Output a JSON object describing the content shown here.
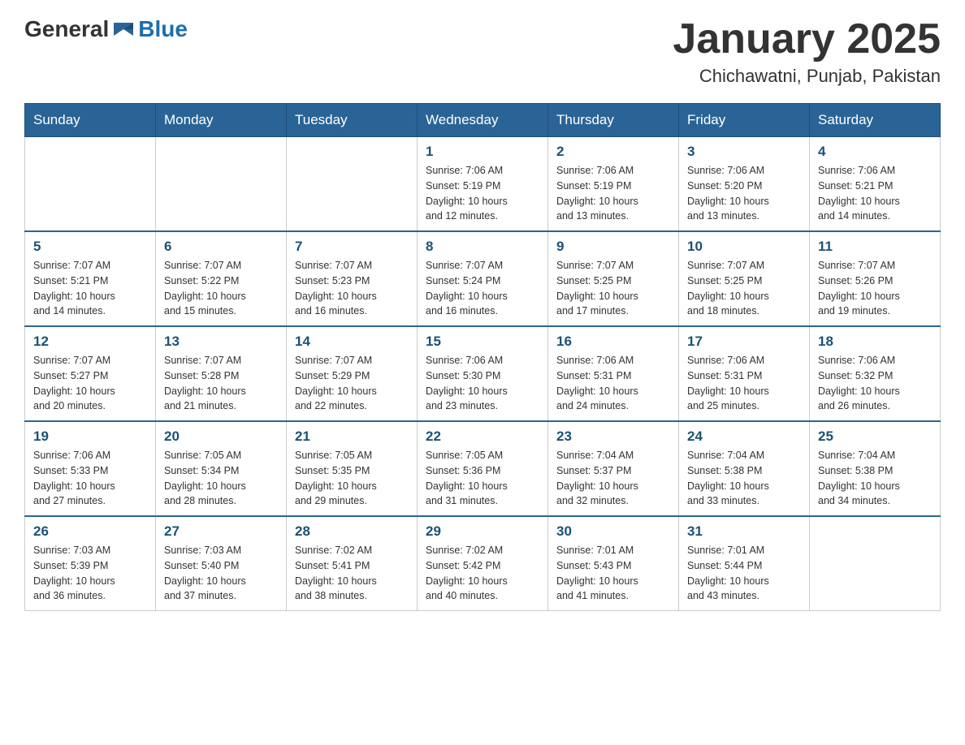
{
  "header": {
    "logo_general": "General",
    "logo_blue": "Blue",
    "month_title": "January 2025",
    "location": "Chichawatni, Punjab, Pakistan"
  },
  "weekdays": [
    "Sunday",
    "Monday",
    "Tuesday",
    "Wednesday",
    "Thursday",
    "Friday",
    "Saturday"
  ],
  "weeks": [
    [
      {
        "day": "",
        "info": ""
      },
      {
        "day": "",
        "info": ""
      },
      {
        "day": "",
        "info": ""
      },
      {
        "day": "1",
        "info": "Sunrise: 7:06 AM\nSunset: 5:19 PM\nDaylight: 10 hours\nand 12 minutes."
      },
      {
        "day": "2",
        "info": "Sunrise: 7:06 AM\nSunset: 5:19 PM\nDaylight: 10 hours\nand 13 minutes."
      },
      {
        "day": "3",
        "info": "Sunrise: 7:06 AM\nSunset: 5:20 PM\nDaylight: 10 hours\nand 13 minutes."
      },
      {
        "day": "4",
        "info": "Sunrise: 7:06 AM\nSunset: 5:21 PM\nDaylight: 10 hours\nand 14 minutes."
      }
    ],
    [
      {
        "day": "5",
        "info": "Sunrise: 7:07 AM\nSunset: 5:21 PM\nDaylight: 10 hours\nand 14 minutes."
      },
      {
        "day": "6",
        "info": "Sunrise: 7:07 AM\nSunset: 5:22 PM\nDaylight: 10 hours\nand 15 minutes."
      },
      {
        "day": "7",
        "info": "Sunrise: 7:07 AM\nSunset: 5:23 PM\nDaylight: 10 hours\nand 16 minutes."
      },
      {
        "day": "8",
        "info": "Sunrise: 7:07 AM\nSunset: 5:24 PM\nDaylight: 10 hours\nand 16 minutes."
      },
      {
        "day": "9",
        "info": "Sunrise: 7:07 AM\nSunset: 5:25 PM\nDaylight: 10 hours\nand 17 minutes."
      },
      {
        "day": "10",
        "info": "Sunrise: 7:07 AM\nSunset: 5:25 PM\nDaylight: 10 hours\nand 18 minutes."
      },
      {
        "day": "11",
        "info": "Sunrise: 7:07 AM\nSunset: 5:26 PM\nDaylight: 10 hours\nand 19 minutes."
      }
    ],
    [
      {
        "day": "12",
        "info": "Sunrise: 7:07 AM\nSunset: 5:27 PM\nDaylight: 10 hours\nand 20 minutes."
      },
      {
        "day": "13",
        "info": "Sunrise: 7:07 AM\nSunset: 5:28 PM\nDaylight: 10 hours\nand 21 minutes."
      },
      {
        "day": "14",
        "info": "Sunrise: 7:07 AM\nSunset: 5:29 PM\nDaylight: 10 hours\nand 22 minutes."
      },
      {
        "day": "15",
        "info": "Sunrise: 7:06 AM\nSunset: 5:30 PM\nDaylight: 10 hours\nand 23 minutes."
      },
      {
        "day": "16",
        "info": "Sunrise: 7:06 AM\nSunset: 5:31 PM\nDaylight: 10 hours\nand 24 minutes."
      },
      {
        "day": "17",
        "info": "Sunrise: 7:06 AM\nSunset: 5:31 PM\nDaylight: 10 hours\nand 25 minutes."
      },
      {
        "day": "18",
        "info": "Sunrise: 7:06 AM\nSunset: 5:32 PM\nDaylight: 10 hours\nand 26 minutes."
      }
    ],
    [
      {
        "day": "19",
        "info": "Sunrise: 7:06 AM\nSunset: 5:33 PM\nDaylight: 10 hours\nand 27 minutes."
      },
      {
        "day": "20",
        "info": "Sunrise: 7:05 AM\nSunset: 5:34 PM\nDaylight: 10 hours\nand 28 minutes."
      },
      {
        "day": "21",
        "info": "Sunrise: 7:05 AM\nSunset: 5:35 PM\nDaylight: 10 hours\nand 29 minutes."
      },
      {
        "day": "22",
        "info": "Sunrise: 7:05 AM\nSunset: 5:36 PM\nDaylight: 10 hours\nand 31 minutes."
      },
      {
        "day": "23",
        "info": "Sunrise: 7:04 AM\nSunset: 5:37 PM\nDaylight: 10 hours\nand 32 minutes."
      },
      {
        "day": "24",
        "info": "Sunrise: 7:04 AM\nSunset: 5:38 PM\nDaylight: 10 hours\nand 33 minutes."
      },
      {
        "day": "25",
        "info": "Sunrise: 7:04 AM\nSunset: 5:38 PM\nDaylight: 10 hours\nand 34 minutes."
      }
    ],
    [
      {
        "day": "26",
        "info": "Sunrise: 7:03 AM\nSunset: 5:39 PM\nDaylight: 10 hours\nand 36 minutes."
      },
      {
        "day": "27",
        "info": "Sunrise: 7:03 AM\nSunset: 5:40 PM\nDaylight: 10 hours\nand 37 minutes."
      },
      {
        "day": "28",
        "info": "Sunrise: 7:02 AM\nSunset: 5:41 PM\nDaylight: 10 hours\nand 38 minutes."
      },
      {
        "day": "29",
        "info": "Sunrise: 7:02 AM\nSunset: 5:42 PM\nDaylight: 10 hours\nand 40 minutes."
      },
      {
        "day": "30",
        "info": "Sunrise: 7:01 AM\nSunset: 5:43 PM\nDaylight: 10 hours\nand 41 minutes."
      },
      {
        "day": "31",
        "info": "Sunrise: 7:01 AM\nSunset: 5:44 PM\nDaylight: 10 hours\nand 43 minutes."
      },
      {
        "day": "",
        "info": ""
      }
    ]
  ]
}
